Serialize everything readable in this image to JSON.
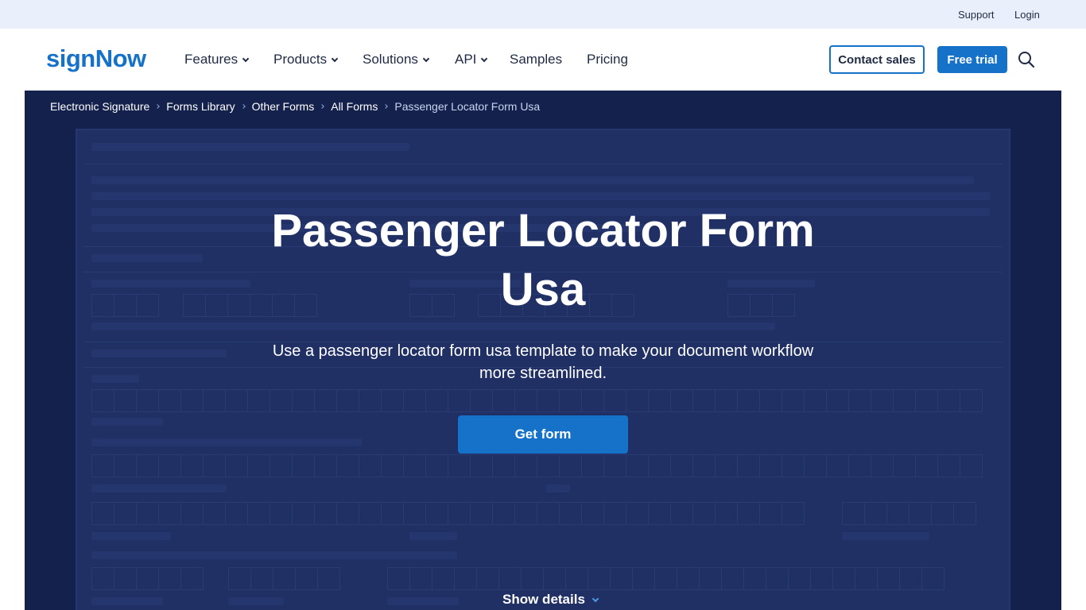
{
  "topbar": {
    "support": "Support",
    "login": "Login"
  },
  "header": {
    "logo": "signNow",
    "nav": [
      "Features",
      "Products",
      "Solutions",
      "API",
      "Samples",
      "Pricing"
    ],
    "contact_sales": "Contact sales",
    "free_trial": "Free trial"
  },
  "breadcrumb": [
    "Electronic Signature",
    "Forms Library",
    "Other Forms",
    "All Forms",
    "Passenger Locator Form Usa"
  ],
  "hero": {
    "title": "Passenger Locator Form Usa",
    "subtitle": "Use a passenger locator form usa template to make your document workflow more streamlined.",
    "get_form": "Get form",
    "show_details": "Show details"
  },
  "colors": {
    "brand": "#1572c8",
    "hero_bg": "#15224e",
    "topbar_bg": "#eaf0fb"
  },
  "icons": [
    "search-icon",
    "chevron-down-icon"
  ]
}
